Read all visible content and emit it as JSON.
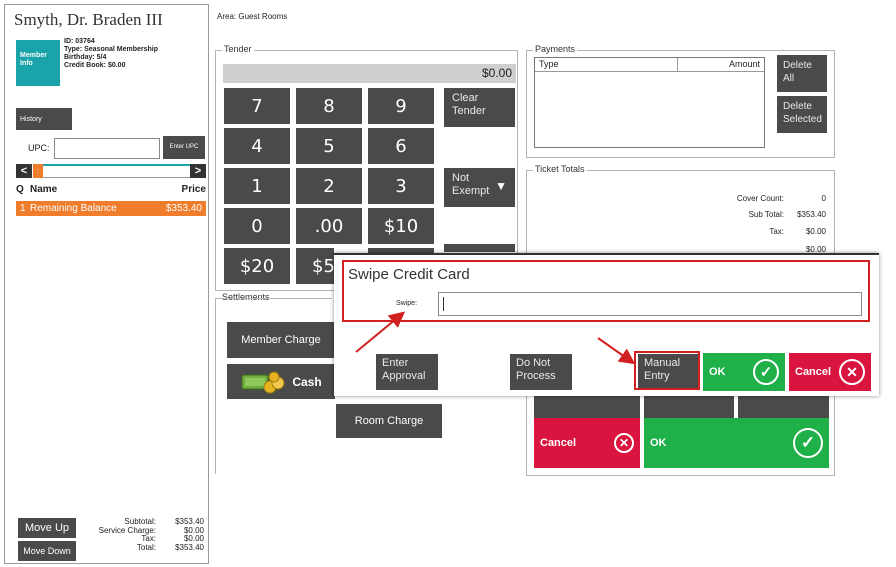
{
  "guest": {
    "name": "Smyth, Dr.  Braden III",
    "member_info_label": "Member Info",
    "id": "ID: 03764",
    "type": "Type: Seasonal Membership",
    "birthday": "Birthday: 5/4",
    "credit_book": "Credit Book: $0.00"
  },
  "left": {
    "history_label": "History",
    "upc_label": "UPC:",
    "upc_value": "",
    "enter_upc_label": "Enter UPC",
    "nav_prev": "<",
    "nav_next": ">",
    "nav_marker": ":",
    "list_headers": {
      "q": "Q",
      "name": "Name",
      "price": "Price"
    },
    "items": [
      {
        "q": "1",
        "name": "Remaining Balance",
        "price": "$353.40"
      }
    ],
    "move_up_label": "Move Up",
    "move_down_label": "Move Down",
    "totals": {
      "subtotal_label": "Subtotal:",
      "subtotal": "$353.40",
      "service_label": "Service Charge:",
      "service": "$0.00",
      "tax_label": "Tax:",
      "tax": "$0.00",
      "total_label": "Total:",
      "total": "$353.40"
    }
  },
  "area": "Area: Guest Rooms",
  "tender": {
    "legend": "Tender",
    "display": "$0.00",
    "keys": [
      "7",
      "8",
      "9",
      "4",
      "5",
      "6",
      "1",
      "2",
      "3",
      "0",
      ".00",
      "$10",
      "$20",
      "$5"
    ],
    "clear_tender": "Clear Tender",
    "not_exempt": "Not Exempt"
  },
  "settlements": {
    "legend": "Settlements",
    "member_charge": "Member Charge",
    "cash": "Cash",
    "room_charge": "Room Charge"
  },
  "payments": {
    "legend": "Payments",
    "col_type": "Type",
    "col_amount": "Amount",
    "delete_all": "Delete All",
    "delete_selected": "Delete Selected"
  },
  "ticket_totals": {
    "legend": "Ticket Totals",
    "cover_count_label": "Cover Count:",
    "cover_count": "0",
    "sub_total_label": "Sub Total:",
    "sub_total": "$353.40",
    "tax_label": "Tax:",
    "tax": "$0.00",
    "gratuity_value": "$0.00",
    "cancel_label": "Cancel",
    "ok_label": "OK"
  },
  "modal": {
    "title": "Swipe Credit Card",
    "swipe_label": "Swipe:",
    "swipe_value": "",
    "enter_approval": "Enter Approval",
    "do_not_process": "Do Not Process",
    "manual_entry": "Manual Entry",
    "ok_label": "OK",
    "cancel_label": "Cancel"
  },
  "colors": {
    "teal": "#1aa3a8",
    "orange": "#f07d2c",
    "dark_button": "#4a4a4a",
    "ok_green": "#1fb04a",
    "cancel_red": "#d9143e",
    "annotation_red": "#d02020"
  },
  "icons": [
    "chevron-left-icon",
    "chevron-right-icon",
    "dropdown-triangle-icon",
    "cash-money-icon",
    "checkmark-circle-icon",
    "close-circle-icon",
    "annotation-arrow"
  ]
}
